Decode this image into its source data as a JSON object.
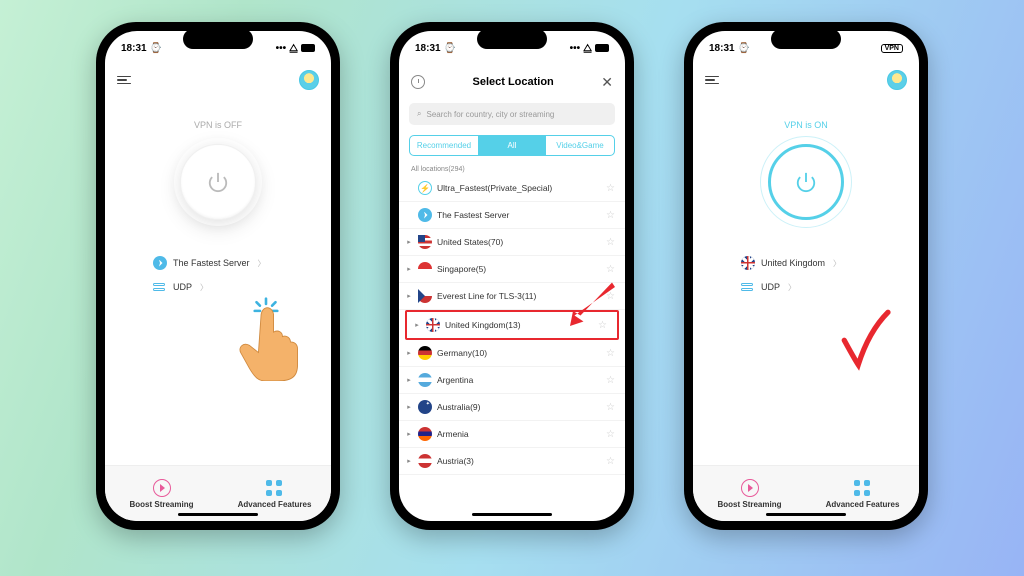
{
  "status": {
    "time": "18:31",
    "right_off": "…",
    "right_vpn": "VPN"
  },
  "screen1": {
    "vpn_status": "VPN is OFF",
    "server": "The Fastest Server",
    "protocol": "UDP",
    "bottom1": "Boost Streaming",
    "bottom2": "Advanced Features"
  },
  "screen2": {
    "title": "Select Location",
    "search_placeholder": "Search for country, city or streaming",
    "tabs": {
      "rec": "Recommended",
      "all": "All",
      "vg": "Video&Game"
    },
    "section": "All locations(294)",
    "items": [
      {
        "name": "Ultra_Fastest(Private_Special)",
        "flag": "flag-bolt",
        "expand": ""
      },
      {
        "name": "The Fastest Server",
        "flag": "flag-fastest",
        "expand": ""
      },
      {
        "name": "United States(70)",
        "flag": "flag-us",
        "expand": "▸"
      },
      {
        "name": "Singapore(5)",
        "flag": "flag-sg",
        "expand": "▸"
      },
      {
        "name": "Everest Line for TLS-3(11)",
        "flag": "flag-cz",
        "expand": "▸"
      },
      {
        "name": "United Kingdom(13)",
        "flag": "flag-uk",
        "expand": "▸",
        "highlight": true
      },
      {
        "name": "Germany(10)",
        "flag": "flag-de",
        "expand": "▸"
      },
      {
        "name": "Argentina",
        "flag": "flag-ar",
        "expand": "▸"
      },
      {
        "name": "Australia(9)",
        "flag": "flag-au",
        "expand": "▸"
      },
      {
        "name": "Armenia",
        "flag": "flag-am",
        "expand": "▸"
      },
      {
        "name": "Austria(3)",
        "flag": "flag-at",
        "expand": "▸"
      }
    ]
  },
  "screen3": {
    "vpn_status": "VPN is ON",
    "server": "United Kingdom",
    "protocol": "UDP",
    "bottom1": "Boost Streaming",
    "bottom2": "Advanced Features"
  }
}
